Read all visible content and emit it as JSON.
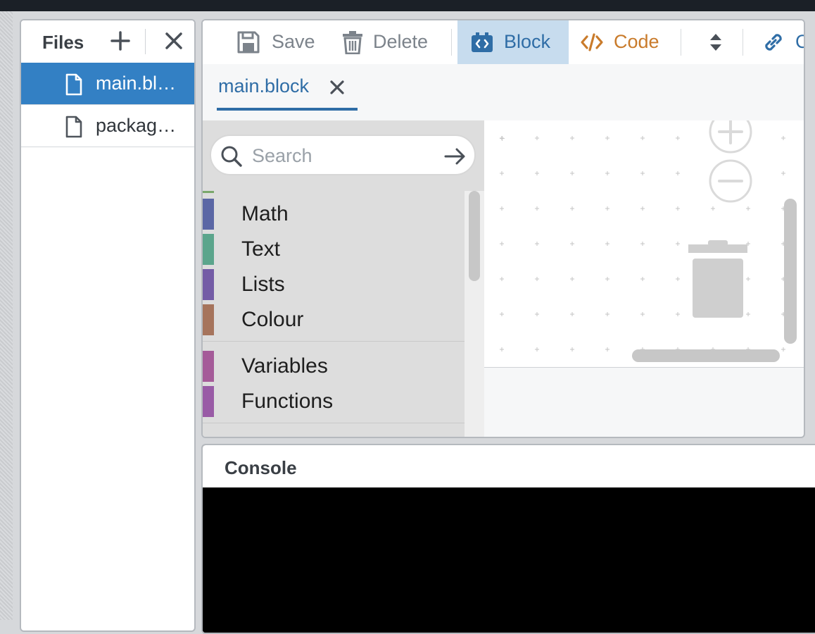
{
  "files": {
    "title": "Files",
    "items": [
      {
        "name": "main.bl…",
        "active": true
      },
      {
        "name": "packag…",
        "active": false
      }
    ]
  },
  "toolbar": {
    "save_label": "Save",
    "delete_label": "Delete",
    "block_label": "Block",
    "code_label": "Code",
    "link_label_partial": "C"
  },
  "tabs": [
    {
      "label": "main.block"
    }
  ],
  "blocks": {
    "search_placeholder": "Search",
    "categories": [
      {
        "label": "Math",
        "color": "#5b67a5"
      },
      {
        "label": "Text",
        "color": "#5ba58c"
      },
      {
        "label": "Lists",
        "color": "#745ca6"
      },
      {
        "label": "Colour",
        "color": "#a6745c"
      },
      {
        "label": "Variables",
        "color": "#a55b99"
      },
      {
        "label": "Functions",
        "color": "#995ba6"
      }
    ]
  },
  "console": {
    "title": "Console"
  },
  "colors": {
    "accent": "#3380c4",
    "block_tab_bg": "#c7dcee",
    "code_orange": "#c97b2b"
  }
}
